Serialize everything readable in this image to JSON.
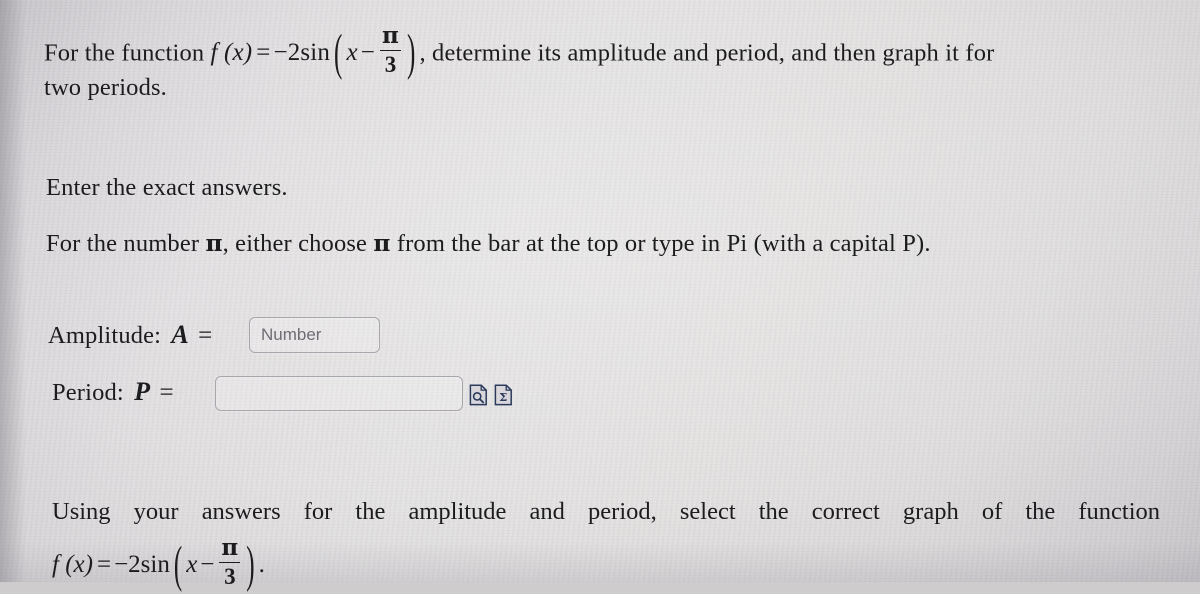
{
  "page": {
    "background_color": "#ded FB",
    "text_color": "#1c1c1e",
    "accent_icon_color": "#2b3a5c"
  },
  "problem": {
    "intro_prefix": "For the function",
    "function_expression": {
      "f_of_x": "f (x)",
      "equals": "=",
      "coefficient": "−2",
      "trig": "sin",
      "open_paren": "(",
      "variable": "x",
      "minus": "−",
      "fraction_numerator": "π",
      "fraction_denominator": "3",
      "close_paren": ")",
      "plain_text": "f (x) = −2 sin (x − π/3)"
    },
    "intro_suffix": ", determine its amplitude and period, and then graph it for",
    "intro_line2": "two periods."
  },
  "instructions": {
    "line1": "Enter the exact answers.",
    "line2_part1": "For the number",
    "line2_pi_1": "π",
    "line2_part2": ", either choose",
    "line2_pi_2": "π",
    "line2_part3": "from the bar at the top or type in Pi (with a capital P).",
    "line2_plain": "For the number π, either choose π from the bar at the top or type in Pi (with a capital P)."
  },
  "answers": {
    "amplitude": {
      "label_text": "Amplitude:",
      "label_symbol": "A",
      "label_equals": "=",
      "value": "",
      "placeholder": "Number"
    },
    "period": {
      "label_text": "Period:",
      "label_symbol": "P",
      "label_equals": "=",
      "value": "",
      "placeholder": ""
    },
    "tools": [
      {
        "name": "preview-answer-icon",
        "glyph": "document-magnifier",
        "title": "Preview"
      },
      {
        "name": "math-editor-icon",
        "glyph": "document-sigma",
        "title": "Math editor"
      }
    ]
  },
  "followup": {
    "paragraph": "Using your answers for the amplitude and period, select the correct graph of the function",
    "words": [
      "Using",
      "your",
      "answers",
      "for",
      "the",
      "amplitude",
      "and",
      "period,",
      "select",
      "the",
      "correct",
      "graph",
      "of",
      "the",
      "function"
    ],
    "function_expression": {
      "f_of_x": "f (x)",
      "equals": "=",
      "coefficient": "−2",
      "trig": "sin",
      "open_paren": "(",
      "variable": "x",
      "minus": "−",
      "fraction_numerator": "π",
      "fraction_denominator": "3",
      "close_paren": ")",
      "period_mark": ".",
      "plain_text": "f (x) = −2 sin (x − π/3)."
    }
  }
}
